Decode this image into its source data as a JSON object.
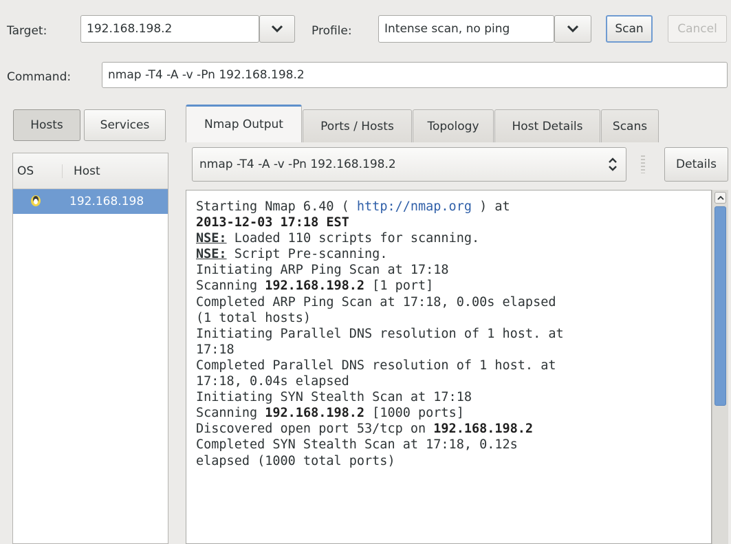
{
  "toolbar": {
    "target_label": "Target:",
    "target_value": "192.168.198.2",
    "profile_label": "Profile:",
    "profile_value": "Intense scan, no ping",
    "scan_label": "Scan",
    "cancel_label": "Cancel",
    "command_label": "Command:",
    "command_value": "nmap -T4 -A -v -Pn 192.168.198.2"
  },
  "sidebar": {
    "tabs": [
      {
        "label": "Hosts",
        "active": true
      },
      {
        "label": "Services",
        "active": false
      }
    ],
    "columns": {
      "os": "OS",
      "host": "Host"
    },
    "hosts": [
      {
        "os_icon": "linux-penguin-icon",
        "address": "192.168.198"
      }
    ]
  },
  "main": {
    "tabs": [
      {
        "label": "Nmap Output",
        "active": true
      },
      {
        "label": "Ports / Hosts",
        "active": false
      },
      {
        "label": "Topology",
        "active": false
      },
      {
        "label": "Host Details",
        "active": false
      },
      {
        "label": "Scans",
        "active": false
      }
    ],
    "output_select": "nmap -T4 -A -v -Pn 192.168.198.2",
    "details_label": "Details",
    "output_lines": [
      "Starting Nmap 6.40 ( http://nmap.org ) at",
      "2013-12-03 17:18 EST",
      "NSE: Loaded 110 scripts for scanning.",
      "NSE: Script Pre-scanning.",
      "Initiating ARP Ping Scan at 17:18",
      "Scanning 192.168.198.2 [1 port]",
      "Completed ARP Ping Scan at 17:18, 0.00s elapsed",
      "(1 total hosts)",
      "Initiating Parallel DNS resolution of 1 host. at",
      "17:18",
      "Completed Parallel DNS resolution of 1 host. at",
      "17:18, 0.04s elapsed",
      "Initiating SYN Stealth Scan at 17:18",
      "Scanning 192.168.198.2 [1000 ports]",
      "Discovered open port 53/tcp on 192.168.198.2",
      "Completed SYN Stealth Scan at 17:18, 0.12s",
      "elapsed (1000 total ports)"
    ]
  },
  "colors": {
    "accent": "#6f9bd1",
    "link": "#2f5fa8",
    "window_bg": "#ecebe9"
  }
}
